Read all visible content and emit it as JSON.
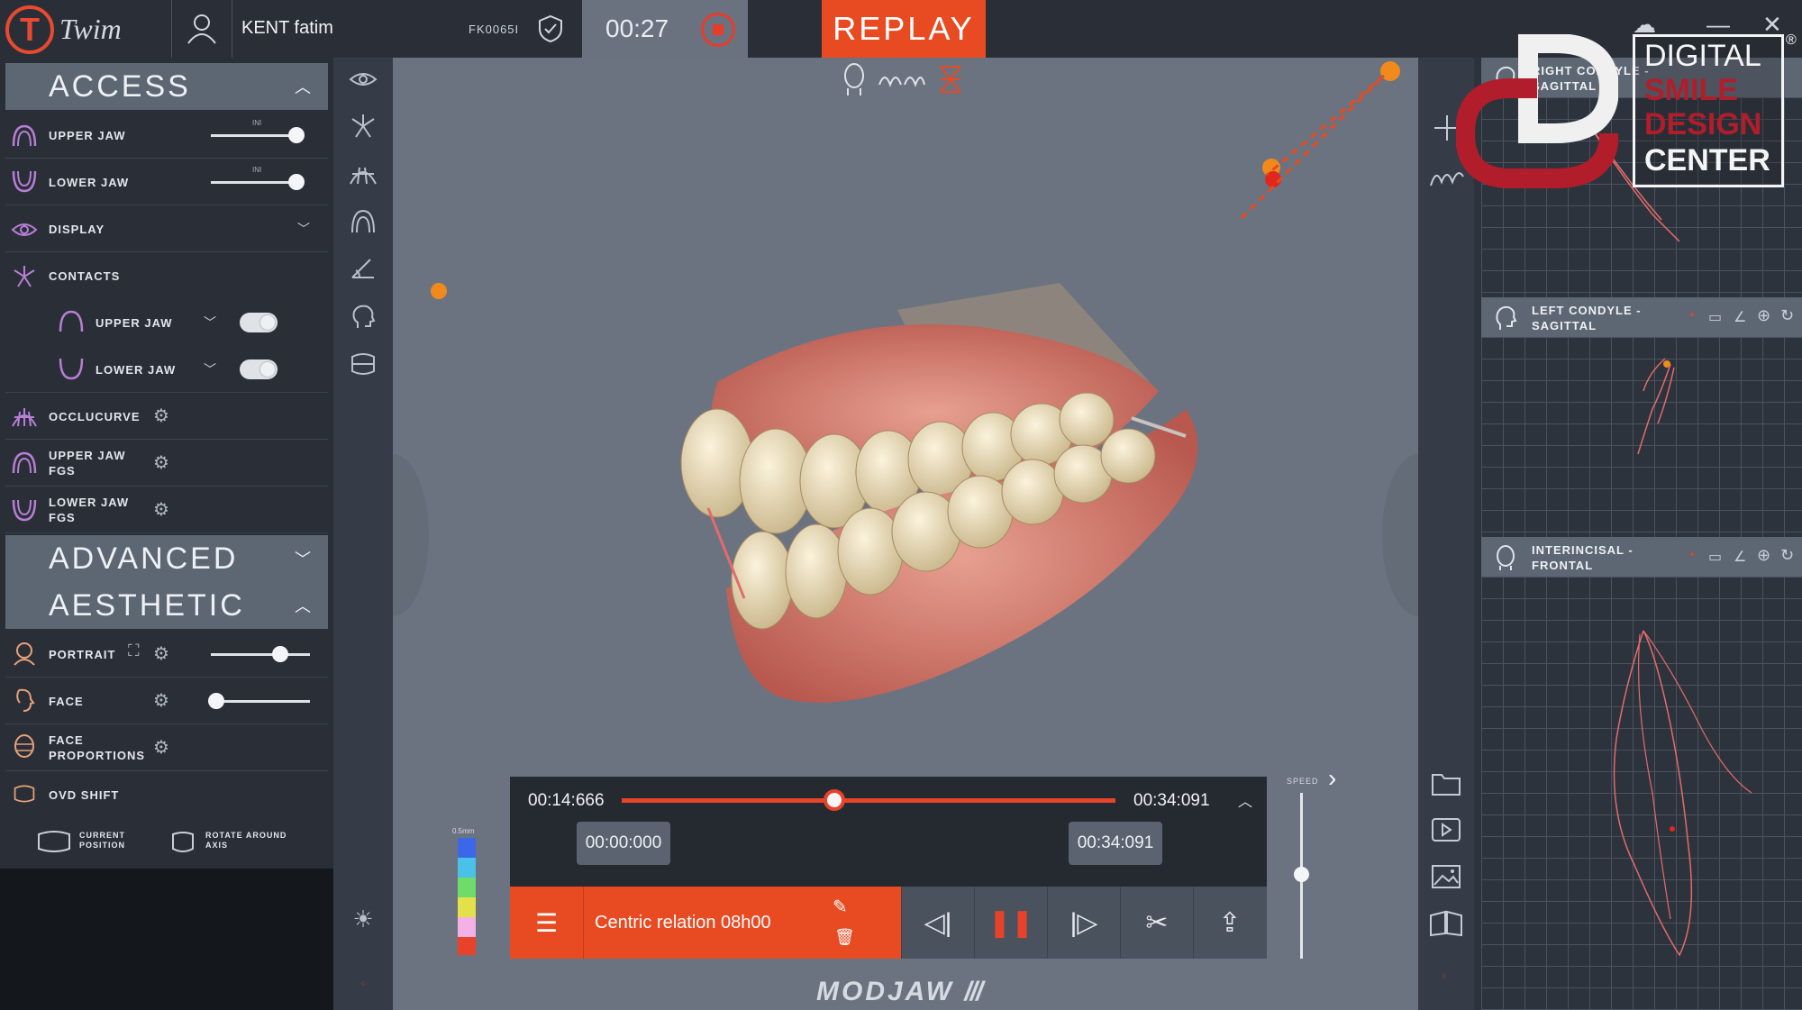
{
  "app": {
    "logo_letter": "T",
    "logo_text": "Twim",
    "patient_name": "KENT fatim",
    "patient_id": "FK0065I",
    "timer": "00:27",
    "replay_label": "REPLAY",
    "window_controls": [
      "—",
      "✕"
    ],
    "brand_color": "#e84a22"
  },
  "left": {
    "access": {
      "title": "ACCESS",
      "upper_jaw": "UPPER JAW",
      "lower_jaw": "LOWER JAW",
      "ini": "INI",
      "display": "DISPLAY",
      "contacts": "CONTACTS",
      "contacts_upper": "UPPER JAW",
      "contacts_lower": "LOWER JAW",
      "occlucurve": "OCCLUCURVE",
      "upper_jaw_fgs": [
        "UPPER JAW",
        "FGS"
      ],
      "lower_jaw_fgs": [
        "LOWER JAW",
        "FGS"
      ]
    },
    "advanced": {
      "title": "ADVANCED"
    },
    "aesthetic": {
      "title": "AESTHETIC",
      "portrait": "PORTRAIT",
      "portrait_level": 0.7,
      "face": "FACE",
      "face_level": 0.05,
      "face_proportions": [
        "FACE",
        "PROPORTIONS"
      ],
      "ovd_shift": "OVD SHIFT",
      "current_position": [
        "CURRENT",
        "POSITION"
      ],
      "rotate_axis": [
        "ROTATE AROUND",
        "AXIS"
      ]
    }
  },
  "right": {
    "graph1": [
      "RIGHT CONDYLE -",
      "SAGITTAL"
    ],
    "graph2": [
      "LEFT CONDYLE -",
      "SAGITTAL"
    ],
    "graph3": [
      "INTERINCISAL -",
      "FRONTAL"
    ]
  },
  "timeline": {
    "current_time": "00:14:666",
    "end_time": "00:34:091",
    "range_start": "00:00:000",
    "range_end": "00:34:091",
    "progress": 0.43,
    "recording_name": "Centric relation 08h00",
    "speed_label": "SPEED",
    "colorbar_label": "0.5mm"
  },
  "brand_footer": "MODJAW",
  "watermark": {
    "lines": [
      "DIGITAL",
      "SMILE",
      "DESIGN",
      "CENTER"
    ]
  }
}
